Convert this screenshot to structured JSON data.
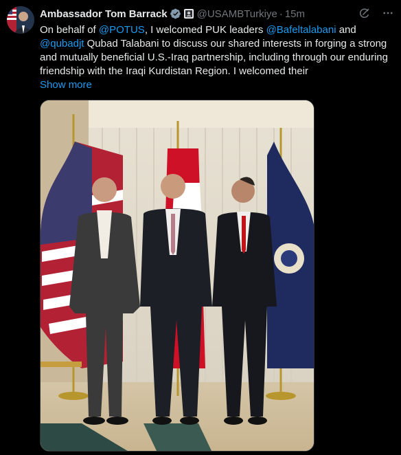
{
  "author": {
    "display_name": "Ambassador Tom Barrack",
    "handle": "@USAMBTurkiye",
    "separator": "·",
    "time": "15m",
    "verified_icon": "verified-badge-icon",
    "affiliation_icon": "government-affiliation-icon"
  },
  "tweet": {
    "segments": [
      {
        "t": "On behalf of ",
        "link": false
      },
      {
        "t": "@POTUS",
        "link": true
      },
      {
        "t": ", I welcomed PUK leaders ",
        "link": false
      },
      {
        "t": "@Bafeltalabani",
        "link": true
      },
      {
        "t": " and ",
        "link": false
      },
      {
        "t": "@qubadjt",
        "link": true
      },
      {
        "t": " Qubad Talabani to discuss our shared interests in forging a strong and mutually beneficial U.S.-Iraq partnership, including through our enduring friendship with the Iraqi Kurdistan Region.  I welcomed their",
        "link": false
      }
    ],
    "show_more": "Show more"
  },
  "colors": {
    "background": "#000000",
    "text": "#e7e9ea",
    "secondary": "#71767b",
    "link": "#1d9bf0",
    "border": "#2f3336"
  },
  "icons": {
    "grok": "grok-icon",
    "more": "more-options-icon"
  }
}
